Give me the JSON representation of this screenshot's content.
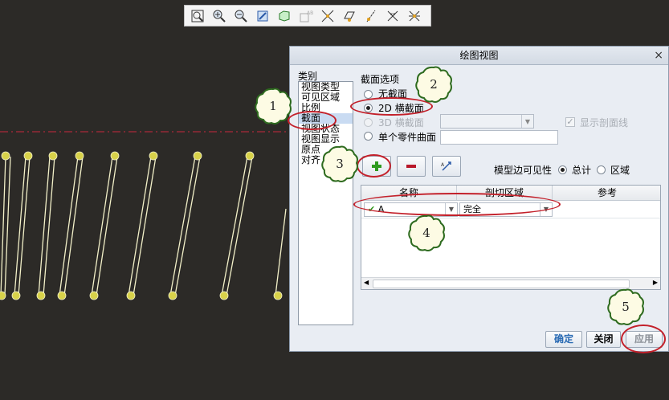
{
  "toolbar": {
    "icons": [
      "zoom-fit-icon",
      "zoom-in-icon",
      "zoom-out-icon",
      "repaint-icon",
      "orient-icon",
      "saved-views-icon",
      "datum-display-icon",
      "plane-display-icon",
      "axis-display-icon",
      "point-display-icon",
      "csys-display-icon"
    ]
  },
  "dialog": {
    "title": "绘图视图",
    "close": "×",
    "category_label": "类别",
    "categories": [
      "视图类型",
      "可见区域",
      "比例",
      "截面",
      "视图状态",
      "视图显示",
      "原点",
      "对齐"
    ],
    "selected_category": "截面",
    "section_options_label": "截面选项",
    "options": {
      "none": "无截面",
      "two_d": "2D 横截面",
      "three_d": "3D 横截面",
      "single_part": "单个零件曲面"
    },
    "show_hatch_label": "显示剖面线",
    "edge_visibility_label": "模型边可见性",
    "total_label": "总计",
    "area_label": "区域",
    "table": {
      "col_name": "名称",
      "col_cut_region": "剖切区域",
      "col_reference": "参考",
      "row_name": "A",
      "row_cut_region": "完全"
    },
    "buttons": {
      "ok": "确定",
      "close": "关闭",
      "apply": "应用"
    }
  },
  "annotations": [
    "1",
    "2",
    "3",
    "4",
    "5"
  ],
  "colors": {
    "canvas_bg": "#2c2a27",
    "dialog_bg": "#e9edf3",
    "annotation_ring": "#c3202a",
    "badge_border": "#2e6b1f",
    "badge_fill": "#fdfbe4",
    "coil": "#f2f0c8",
    "coil_end": "#d8d24a",
    "center_line": "#c8283c",
    "add_icon": "#2f9a1f",
    "remove_icon": "#b8182a"
  }
}
